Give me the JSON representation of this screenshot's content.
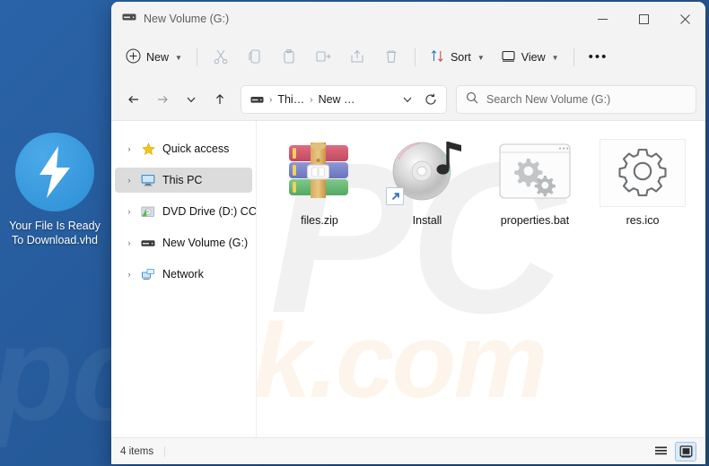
{
  "desktop": {
    "watermark": "pcrisk.com",
    "icon": {
      "name": "Your File Is Ready To Download.vhd",
      "glyph": "lightning-bolt",
      "circle_color": "#3a9ade"
    }
  },
  "window": {
    "title": "New Volume (G:)",
    "title_icon": "drive-icon",
    "controls": {
      "minimize": "–",
      "maximize": "☐",
      "close": "✕"
    }
  },
  "toolbar": {
    "new_label": "New",
    "sort_label": "Sort",
    "view_label": "View",
    "more_label": "•••",
    "buttons": [
      {
        "name": "cut",
        "icon": "scissors-icon"
      },
      {
        "name": "copy",
        "icon": "copy-icon"
      },
      {
        "name": "paste",
        "icon": "paste-icon"
      },
      {
        "name": "rename",
        "icon": "rename-icon"
      },
      {
        "name": "share",
        "icon": "share-icon"
      },
      {
        "name": "delete",
        "icon": "trash-icon"
      }
    ]
  },
  "address": {
    "back": "←",
    "forward": "→",
    "recent": "∨",
    "up": "↑",
    "crumb_icon": "drive-icon",
    "crumbs": [
      "Thi…",
      "New …"
    ],
    "separator": "›",
    "dropdown": "∨",
    "refresh": "↻"
  },
  "search": {
    "placeholder": "Search New Volume (G:)",
    "icon": "search-icon"
  },
  "sidebar": {
    "items": [
      {
        "label": "Quick access",
        "icon": "star-icon",
        "arrow": "›",
        "selected": false
      },
      {
        "label": "This PC",
        "icon": "monitor-icon",
        "arrow": "›",
        "selected": true
      },
      {
        "label": "DVD Drive (D:) CCCC",
        "icon": "dvd-drive-icon",
        "arrow": "›",
        "selected": false
      },
      {
        "label": "New Volume (G:)",
        "icon": "drive-icon",
        "arrow": "›",
        "selected": false
      },
      {
        "label": "Network",
        "icon": "network-icon",
        "arrow": "›",
        "selected": false
      }
    ]
  },
  "content": {
    "watermark_big": "PC",
    "watermark_small": "risk.com",
    "files": [
      {
        "name": "files.zip",
        "icon": "winrar-archive-icon",
        "framed": false,
        "shortcut": false
      },
      {
        "name": "Install",
        "icon": "disc-media-icon",
        "framed": false,
        "shortcut": true
      },
      {
        "name": "properties.bat",
        "icon": "window-gears-icon",
        "framed": true,
        "shortcut": false
      },
      {
        "name": "res.ico",
        "icon": "gear-outline-icon",
        "framed": true,
        "shortcut": false
      }
    ]
  },
  "statusbar": {
    "items_count": "4 items",
    "list_view_icon": "list-view-icon",
    "large_icons_view_icon": "large-icons-view-icon",
    "active_view": "large-icons"
  }
}
